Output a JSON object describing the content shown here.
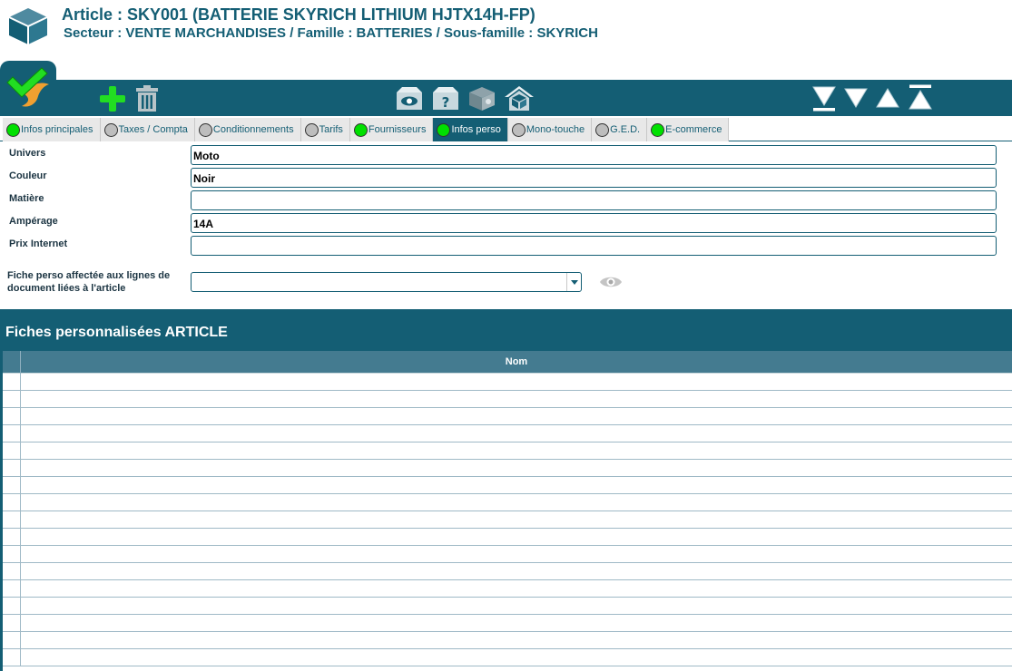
{
  "header": {
    "title": "Article : SKY001 (BATTERIE SKYRICH LITHIUM HJTX14H-FP)",
    "subtitle": "Secteur : VENTE MARCHANDISES / Famille : BATTERIES / Sous-famille : SKYRICH"
  },
  "tabs": [
    {
      "label": "Infos principales",
      "status": "green",
      "active": false
    },
    {
      "label": "Taxes / Compta",
      "status": "gray",
      "active": false
    },
    {
      "label": "Conditionnements",
      "status": "gray",
      "active": false
    },
    {
      "label": "Tarifs",
      "status": "gray",
      "active": false
    },
    {
      "label": "Fournisseurs",
      "status": "green",
      "active": false
    },
    {
      "label": "Infos perso",
      "status": "green",
      "active": true
    },
    {
      "label": "Mono-touche",
      "status": "gray",
      "active": false
    },
    {
      "label": "G.E.D.",
      "status": "gray",
      "active": false
    },
    {
      "label": "E-commerce",
      "status": "green",
      "active": false
    }
  ],
  "form": {
    "fields": [
      {
        "label": "Univers",
        "value": "Moto"
      },
      {
        "label": "Couleur",
        "value": "Noir"
      },
      {
        "label": "Matière",
        "value": ""
      },
      {
        "label": "Ampérage",
        "value": "14A"
      },
      {
        "label": "Prix Internet",
        "value": ""
      }
    ],
    "fiche_label": "Fiche perso affectée aux lignes de document liées à l'article",
    "fiche_value": ""
  },
  "section": {
    "title": "Fiches personnalisées ARTICLE",
    "column_nom": "Nom",
    "row_count": 17
  },
  "colors": {
    "primary": "#145e74",
    "grid_header": "#447b90",
    "status_green": "#00e000",
    "status_gray": "#bdbdbd",
    "add_green": "#22dd22",
    "validate_orange": "#f0a030"
  },
  "icons": {
    "header": "package-icon",
    "validate": "checkmark-icon",
    "add": "plus-icon",
    "delete": "trash-icon",
    "article_view": "box-eye-icon",
    "article_help": "box-question-icon",
    "article_settings": "box-gear-icon",
    "article_home": "box-home-icon",
    "nav_first": "skip-down-icon",
    "nav_next": "arrow-down-icon",
    "nav_prev": "arrow-up-icon",
    "nav_last": "skip-up-icon",
    "preview": "eye-icon"
  }
}
